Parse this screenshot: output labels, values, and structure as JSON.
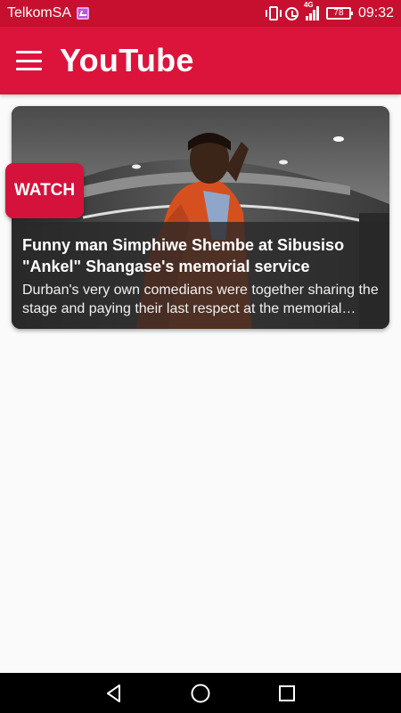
{
  "status_bar": {
    "carrier": "TelkomSA",
    "network": "4G",
    "battery": "78",
    "time": "09:32",
    "icons": [
      "gallery-icon",
      "vibrate-icon",
      "alarm-icon",
      "signal-icon",
      "battery-icon"
    ]
  },
  "app_bar": {
    "title": "YouTube",
    "menu_icon": "hamburger-menu-icon",
    "background_color": "#dc143c"
  },
  "videos": [
    {
      "title": "Funny man Simphiwe Shembe at Sibusiso \"Ankel\" Shangase's memorial service",
      "description": "Durban's very own comedians were together sharing the stage and paying their last respect at the memorial service",
      "badge": "WATCH"
    }
  ],
  "nav_bar": {
    "icons": [
      "back-icon",
      "home-icon",
      "recents-icon"
    ]
  }
}
